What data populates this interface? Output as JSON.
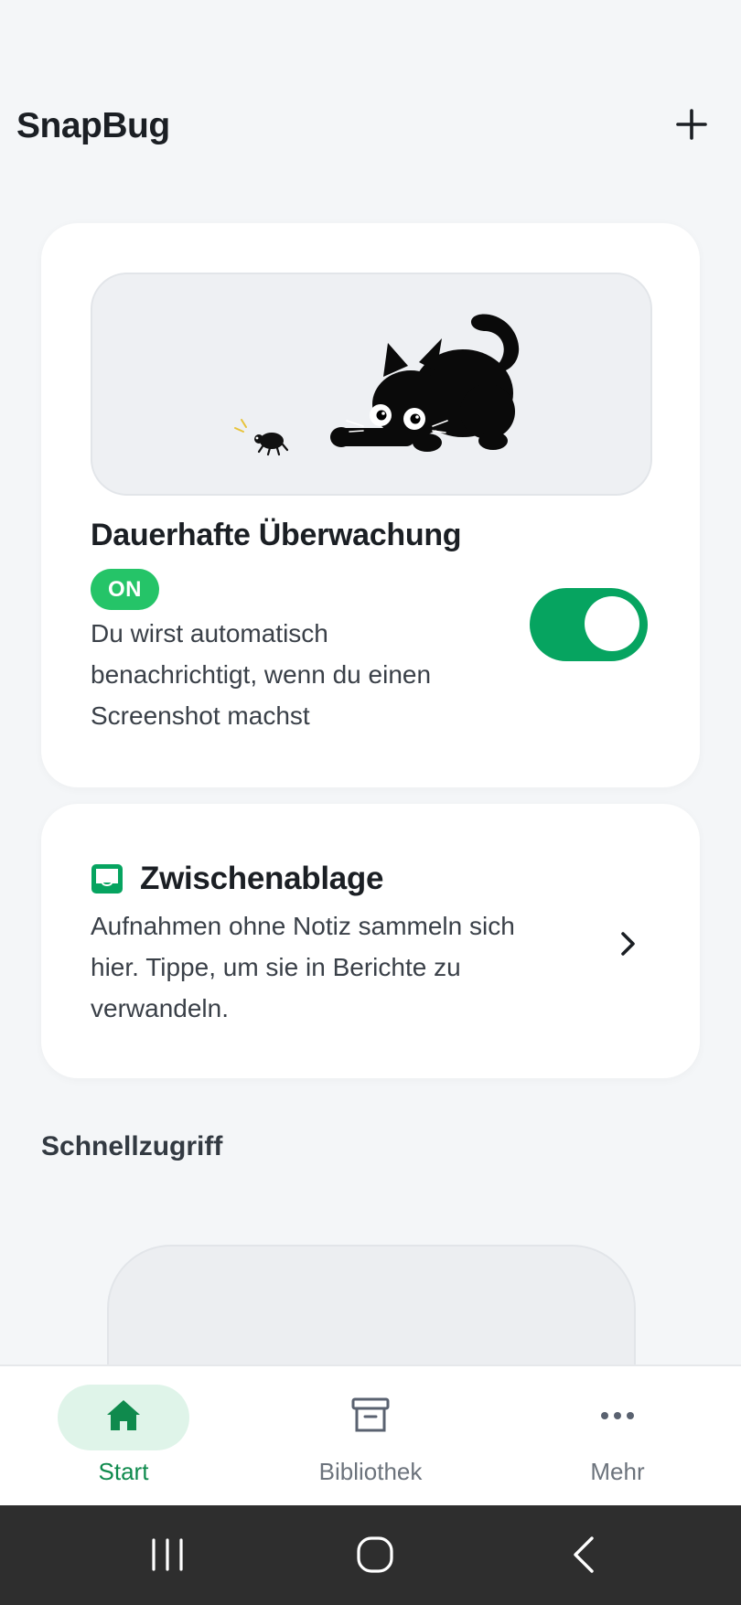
{
  "app": {
    "title": "SnapBug"
  },
  "monitoring": {
    "title": "Dauerhafte Überwachung",
    "status_badge": "ON",
    "description": "Du wirst automatisch benachrichtigt, wenn du einen Screenshot machst",
    "toggle_on": true,
    "illustration_icons": [
      "cat-icon",
      "bug-icon"
    ]
  },
  "clipboard": {
    "title": "Zwischenablage",
    "description": "Aufnahmen ohne Notiz sammeln sich hier. Tippe, um sie in Berichte zu verwandeln.",
    "icon": "inbox-icon"
  },
  "quick_access": {
    "title": "Schnellzugriff"
  },
  "bottom_nav": {
    "items": [
      {
        "label": "Start",
        "icon": "home-icon",
        "active": true
      },
      {
        "label": "Bibliothek",
        "icon": "archive-icon",
        "active": false
      },
      {
        "label": "Mehr",
        "icon": "more-icon",
        "active": false
      }
    ]
  },
  "colors": {
    "accent": "#06a460",
    "badge": "#25c468",
    "active_nav_bg": "#dff4e9",
    "active_nav_text": "#0f8a4d",
    "background": "#f4f6f8",
    "system_bar": "#2e2e2e"
  }
}
